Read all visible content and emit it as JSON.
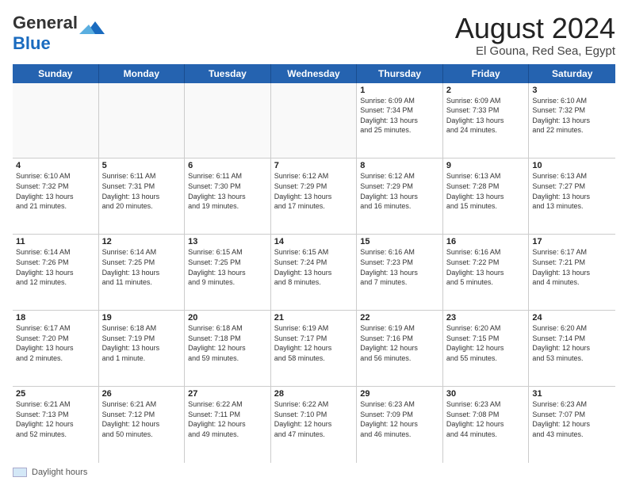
{
  "header": {
    "logo_general": "General",
    "logo_blue": "Blue",
    "month_title": "August 2024",
    "location": "El Gouna, Red Sea, Egypt"
  },
  "calendar": {
    "days_of_week": [
      "Sunday",
      "Monday",
      "Tuesday",
      "Wednesday",
      "Thursday",
      "Friday",
      "Saturday"
    ],
    "rows": [
      [
        {
          "day": "",
          "info": "",
          "empty": true
        },
        {
          "day": "",
          "info": "",
          "empty": true
        },
        {
          "day": "",
          "info": "",
          "empty": true
        },
        {
          "day": "",
          "info": "",
          "empty": true
        },
        {
          "day": "1",
          "info": "Sunrise: 6:09 AM\nSunset: 7:34 PM\nDaylight: 13 hours\nand 25 minutes.",
          "empty": false
        },
        {
          "day": "2",
          "info": "Sunrise: 6:09 AM\nSunset: 7:33 PM\nDaylight: 13 hours\nand 24 minutes.",
          "empty": false
        },
        {
          "day": "3",
          "info": "Sunrise: 6:10 AM\nSunset: 7:32 PM\nDaylight: 13 hours\nand 22 minutes.",
          "empty": false
        }
      ],
      [
        {
          "day": "4",
          "info": "Sunrise: 6:10 AM\nSunset: 7:32 PM\nDaylight: 13 hours\nand 21 minutes.",
          "empty": false
        },
        {
          "day": "5",
          "info": "Sunrise: 6:11 AM\nSunset: 7:31 PM\nDaylight: 13 hours\nand 20 minutes.",
          "empty": false
        },
        {
          "day": "6",
          "info": "Sunrise: 6:11 AM\nSunset: 7:30 PM\nDaylight: 13 hours\nand 19 minutes.",
          "empty": false
        },
        {
          "day": "7",
          "info": "Sunrise: 6:12 AM\nSunset: 7:29 PM\nDaylight: 13 hours\nand 17 minutes.",
          "empty": false
        },
        {
          "day": "8",
          "info": "Sunrise: 6:12 AM\nSunset: 7:29 PM\nDaylight: 13 hours\nand 16 minutes.",
          "empty": false
        },
        {
          "day": "9",
          "info": "Sunrise: 6:13 AM\nSunset: 7:28 PM\nDaylight: 13 hours\nand 15 minutes.",
          "empty": false
        },
        {
          "day": "10",
          "info": "Sunrise: 6:13 AM\nSunset: 7:27 PM\nDaylight: 13 hours\nand 13 minutes.",
          "empty": false
        }
      ],
      [
        {
          "day": "11",
          "info": "Sunrise: 6:14 AM\nSunset: 7:26 PM\nDaylight: 13 hours\nand 12 minutes.",
          "empty": false
        },
        {
          "day": "12",
          "info": "Sunrise: 6:14 AM\nSunset: 7:25 PM\nDaylight: 13 hours\nand 11 minutes.",
          "empty": false
        },
        {
          "day": "13",
          "info": "Sunrise: 6:15 AM\nSunset: 7:25 PM\nDaylight: 13 hours\nand 9 minutes.",
          "empty": false
        },
        {
          "day": "14",
          "info": "Sunrise: 6:15 AM\nSunset: 7:24 PM\nDaylight: 13 hours\nand 8 minutes.",
          "empty": false
        },
        {
          "day": "15",
          "info": "Sunrise: 6:16 AM\nSunset: 7:23 PM\nDaylight: 13 hours\nand 7 minutes.",
          "empty": false
        },
        {
          "day": "16",
          "info": "Sunrise: 6:16 AM\nSunset: 7:22 PM\nDaylight: 13 hours\nand 5 minutes.",
          "empty": false
        },
        {
          "day": "17",
          "info": "Sunrise: 6:17 AM\nSunset: 7:21 PM\nDaylight: 13 hours\nand 4 minutes.",
          "empty": false
        }
      ],
      [
        {
          "day": "18",
          "info": "Sunrise: 6:17 AM\nSunset: 7:20 PM\nDaylight: 13 hours\nand 2 minutes.",
          "empty": false
        },
        {
          "day": "19",
          "info": "Sunrise: 6:18 AM\nSunset: 7:19 PM\nDaylight: 13 hours\nand 1 minute.",
          "empty": false
        },
        {
          "day": "20",
          "info": "Sunrise: 6:18 AM\nSunset: 7:18 PM\nDaylight: 12 hours\nand 59 minutes.",
          "empty": false
        },
        {
          "day": "21",
          "info": "Sunrise: 6:19 AM\nSunset: 7:17 PM\nDaylight: 12 hours\nand 58 minutes.",
          "empty": false
        },
        {
          "day": "22",
          "info": "Sunrise: 6:19 AM\nSunset: 7:16 PM\nDaylight: 12 hours\nand 56 minutes.",
          "empty": false
        },
        {
          "day": "23",
          "info": "Sunrise: 6:20 AM\nSunset: 7:15 PM\nDaylight: 12 hours\nand 55 minutes.",
          "empty": false
        },
        {
          "day": "24",
          "info": "Sunrise: 6:20 AM\nSunset: 7:14 PM\nDaylight: 12 hours\nand 53 minutes.",
          "empty": false
        }
      ],
      [
        {
          "day": "25",
          "info": "Sunrise: 6:21 AM\nSunset: 7:13 PM\nDaylight: 12 hours\nand 52 minutes.",
          "empty": false
        },
        {
          "day": "26",
          "info": "Sunrise: 6:21 AM\nSunset: 7:12 PM\nDaylight: 12 hours\nand 50 minutes.",
          "empty": false
        },
        {
          "day": "27",
          "info": "Sunrise: 6:22 AM\nSunset: 7:11 PM\nDaylight: 12 hours\nand 49 minutes.",
          "empty": false
        },
        {
          "day": "28",
          "info": "Sunrise: 6:22 AM\nSunset: 7:10 PM\nDaylight: 12 hours\nand 47 minutes.",
          "empty": false
        },
        {
          "day": "29",
          "info": "Sunrise: 6:23 AM\nSunset: 7:09 PM\nDaylight: 12 hours\nand 46 minutes.",
          "empty": false
        },
        {
          "day": "30",
          "info": "Sunrise: 6:23 AM\nSunset: 7:08 PM\nDaylight: 12 hours\nand 44 minutes.",
          "empty": false
        },
        {
          "day": "31",
          "info": "Sunrise: 6:23 AM\nSunset: 7:07 PM\nDaylight: 12 hours\nand 43 minutes.",
          "empty": false
        }
      ]
    ]
  },
  "footer": {
    "daylight_label": "Daylight hours"
  }
}
